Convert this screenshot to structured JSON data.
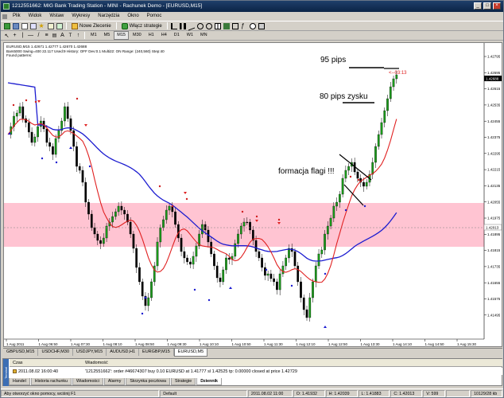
{
  "window": {
    "title": "1212551662: MIG Bank Trading Station - MINI - Rachunek Demo - [EURUSD,M15]",
    "controls": [
      "_",
      "□",
      "×"
    ]
  },
  "menu": [
    "Plik",
    "Widok",
    "Wstaw",
    "Wykresy",
    "Narzędzia",
    "Okno",
    "Pomoc"
  ],
  "toolbar": {
    "new_order": "Nowe Zlecenie",
    "strategies": "Włącz strategie"
  },
  "timeframes": [
    "M1",
    "M5",
    "M15",
    "M30",
    "H1",
    "H4",
    "D1",
    "W1",
    "MN"
  ],
  "active_timeframe": "M15",
  "chart_header": {
    "line1": "EURUSD,M15  1.42671 1.42777 1.42670 1.42688",
    "line2": "Bars5000  Swing=400  22.117  Used:9  History: OFF Dev:0.1  Multi22: ON  Range: (240,560)  Step:40",
    "line3": "Found patterns:"
  },
  "chart_data": {
    "type": "candlestick",
    "symbol": "EURUSD",
    "timeframe": "M15",
    "y_ticks": [
      "1.42795",
      "1.42695",
      "1.42615",
      "1.42535",
      "1.42455",
      "1.42375",
      "1.42295",
      "1.42215",
      "1.42135",
      "1.42055",
      "1.41975",
      "1.41895",
      "1.41815",
      "1.41735",
      "1.41655",
      "1.41575",
      "1.41495"
    ],
    "price_labels": {
      "current": "1.42688",
      "bid": "1.42013"
    },
    "x_ticks": [
      "1 Aug 2011",
      "1 Aug 06:50",
      "1 Aug 07:30",
      "1 Aug 08:10",
      "1 Aug 08:50",
      "1 Aug 09:30",
      "1 Aug 10:10",
      "1 Aug 10:50",
      "1 Aug 11:30",
      "1 Aug 12:10",
      "1 Aug 12:50",
      "1 Aug 13:30",
      "1 Aug 14:10",
      "1 Aug 14:50",
      "1 Aug 15:30"
    ],
    "annotations": [
      "95 pips",
      "80 pips zysku",
      "formacja flagi !!!",
      "<--03:13"
    ],
    "series": [
      {
        "name": "",
        "color": "#e02020",
        "kind": "moving-average"
      },
      {
        "name": "",
        "color": "#1c1cd0",
        "kind": "moving-average"
      }
    ],
    "zone_color": "#ffc0d0"
  },
  "symbol_tabs": [
    "GBPUSD,M15",
    "USDCHF,M30",
    "USDJPY,M15",
    "AUDUSD,H1",
    "EURGBP,M15",
    "EURUSD,M5"
  ],
  "active_symbol_tab": "EURUSD,M5",
  "terminal": {
    "side_label": "Terminal",
    "col_time": "Czas",
    "col_message": "Wiadomość",
    "row_time": "2011.08.02 16:00:40",
    "row_message": "'1212551662': order #46674307 buy 0.10 EURUSD at 1.41777 sl 1.42525 tp: 0.00000 closed at price 1.42729",
    "tabs": [
      "Handel",
      "Historia rachunku",
      "Wiadomości",
      "Alarmy",
      "Skrzynka pocztowa",
      "Strategie",
      "Dziennik"
    ],
    "active_tab": "Dziennik"
  },
  "status": {
    "help": "Aby otworzyć okno pomocy, wciśnij F1",
    "profile": "Default",
    "time": "2011.08.02 11:00",
    "open": "O: 1.41932",
    "high": "H: 1.42039",
    "low": "L: 1.41883",
    "close": "C: 1.42013",
    "volume": "V: 599",
    "traffic": "10129/28 kb"
  }
}
